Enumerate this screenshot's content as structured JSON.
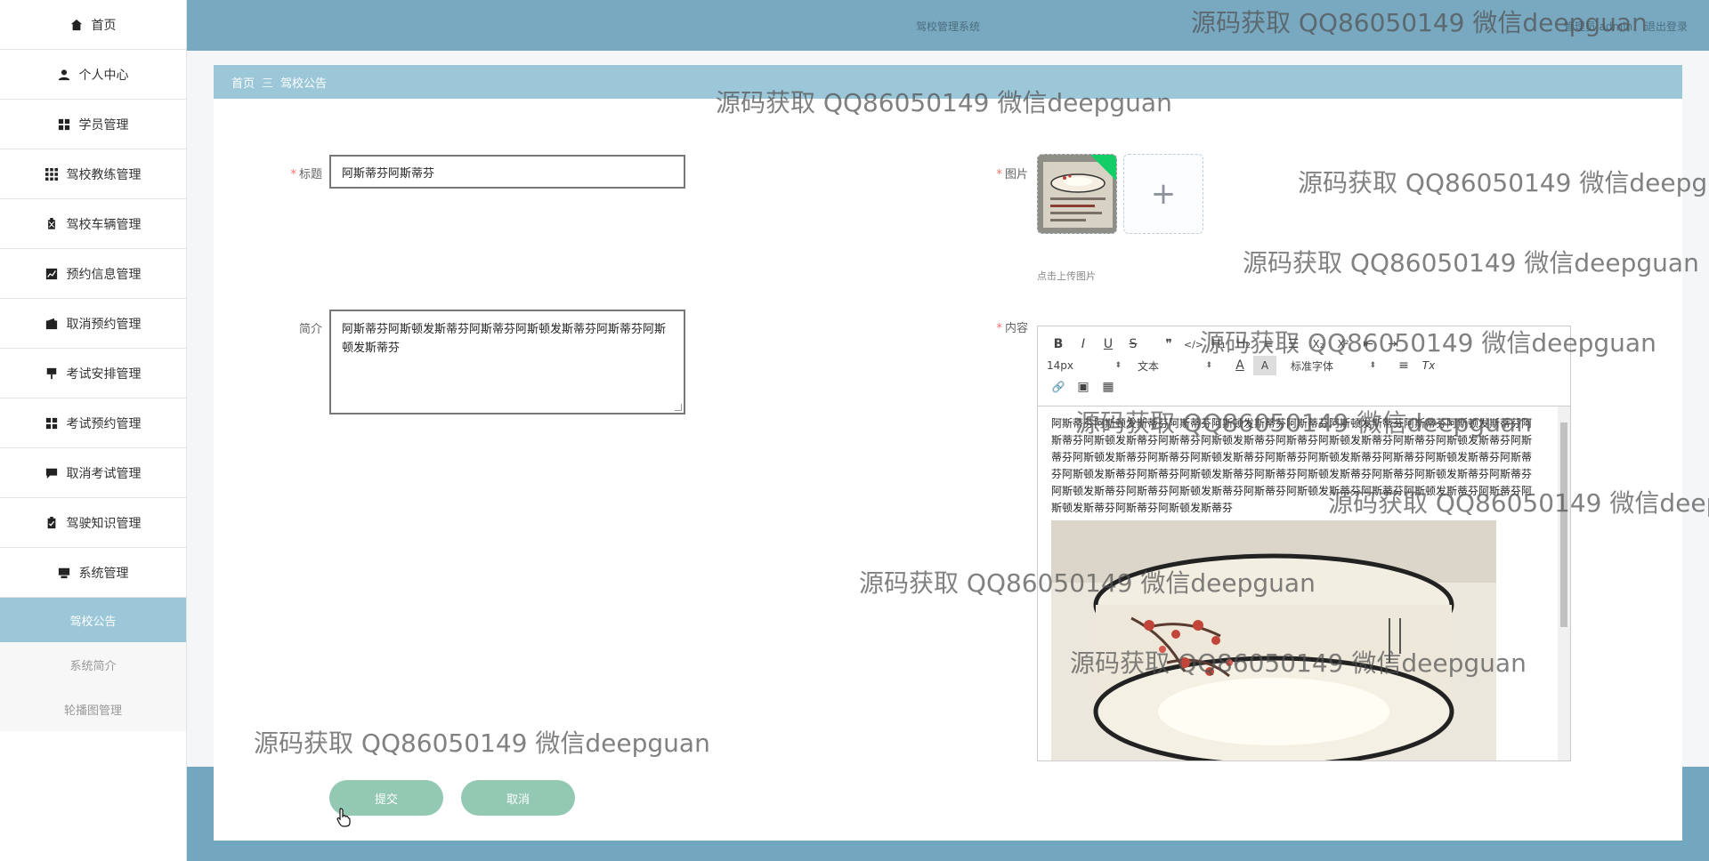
{
  "header": {
    "title": "驾校管理系统",
    "user_text": "管理员 admin",
    "logout_label": "退出登录"
  },
  "sidebar": {
    "items": [
      {
        "label": "首页",
        "icon": "home-icon"
      },
      {
        "label": "个人中心",
        "icon": "user-icon"
      },
      {
        "label": "学员管理",
        "icon": "grid-icon"
      },
      {
        "label": "驾校教练管理",
        "icon": "apps-icon"
      },
      {
        "label": "驾校车辆管理",
        "icon": "clipboard-x-icon"
      },
      {
        "label": "预约信息管理",
        "icon": "chart-icon"
      },
      {
        "label": "取消预约管理",
        "icon": "wallet-icon"
      },
      {
        "label": "考试安排管理",
        "icon": "sign-icon"
      },
      {
        "label": "考试预约管理",
        "icon": "grid-icon"
      },
      {
        "label": "取消考试管理",
        "icon": "chat-icon"
      },
      {
        "label": "驾驶知识管理",
        "icon": "clipboard-check-icon"
      },
      {
        "label": "系统管理",
        "icon": "monitor-icon"
      }
    ],
    "submenu": [
      {
        "label": "驾校公告",
        "active": true
      },
      {
        "label": "系统简介",
        "active": false
      },
      {
        "label": "轮播图管理",
        "active": false
      }
    ]
  },
  "breadcrumb": {
    "home": "首页",
    "separator": "三",
    "current": "驾校公告"
  },
  "form": {
    "title_label": "标题",
    "title_value": "阿斯蒂芬阿斯蒂芬",
    "intro_label": "简介",
    "intro_value": "阿斯蒂芬阿斯顿发斯蒂芬阿斯蒂芬阿斯顿发斯蒂芬阿斯蒂芬阿斯顿发斯蒂芬",
    "image_label": "图片",
    "upload_tip": "点击上传图片",
    "content_label": "内容",
    "content_text": "阿斯蒂芬阿斯顿发斯蒂芬阿斯蒂芬阿斯顿发斯蒂芬阿斯蒂芬阿斯顿发斯蒂芬阿斯蒂芬阿斯顿发斯蒂芬阿斯蒂芬阿斯顿发斯蒂芬阿斯蒂芬阿斯顿发斯蒂芬阿斯蒂芬阿斯顿发斯蒂芬阿斯蒂芬阿斯顿发斯蒂芬阿斯蒂芬阿斯顿发斯蒂芬阿斯蒂芬阿斯顿发斯蒂芬阿斯蒂芬阿斯顿发斯蒂芬阿斯蒂芬阿斯顿发斯蒂芬阿斯蒂芬阿斯顿发斯蒂芬阿斯蒂芬阿斯顿发斯蒂芬阿斯蒂芬阿斯顿发斯蒂芬阿斯蒂芬阿斯顿发斯蒂芬阿斯蒂芬阿斯顿发斯蒂芬阿斯蒂芬阿斯顿发斯蒂芬阿斯蒂芬阿斯顿发斯蒂芬阿斯蒂芬阿斯顿发斯蒂芬阿斯蒂芬阿斯顿发斯蒂芬阿斯蒂芬阿斯顿发斯蒂芬",
    "submit_label": "提交",
    "cancel_label": "取消"
  },
  "editor": {
    "font_size": "14px",
    "block_type": "文本",
    "font_family": "标准字体",
    "tb_bold": "B",
    "tb_italic": "I",
    "tb_underline": "U",
    "tb_strike": "S",
    "tb_quote": "❞",
    "tb_code": "</>",
    "tb_h1": "H₁",
    "tb_h2": "H₂",
    "tb_ol": "≡",
    "tb_ul": "☰",
    "tb_sub": "X₂",
    "tb_sup": "X²",
    "tb_indent_l": "⇤",
    "tb_indent_r": "⇥",
    "tb_color": "A",
    "tb_bg": "A",
    "tb_align": "≡",
    "tb_clear": "Tx",
    "tb_link": "🔗",
    "tb_image": "▣",
    "tb_video": "▦"
  },
  "watermark": "源码获取 QQ86050149 微信deepguan",
  "colors": {
    "header": "#79a9c0",
    "breadcrumb": "#9cc7d8",
    "active_menu": "#9cc7d8",
    "button": "#93c9b3",
    "required": "#f56c6c"
  }
}
